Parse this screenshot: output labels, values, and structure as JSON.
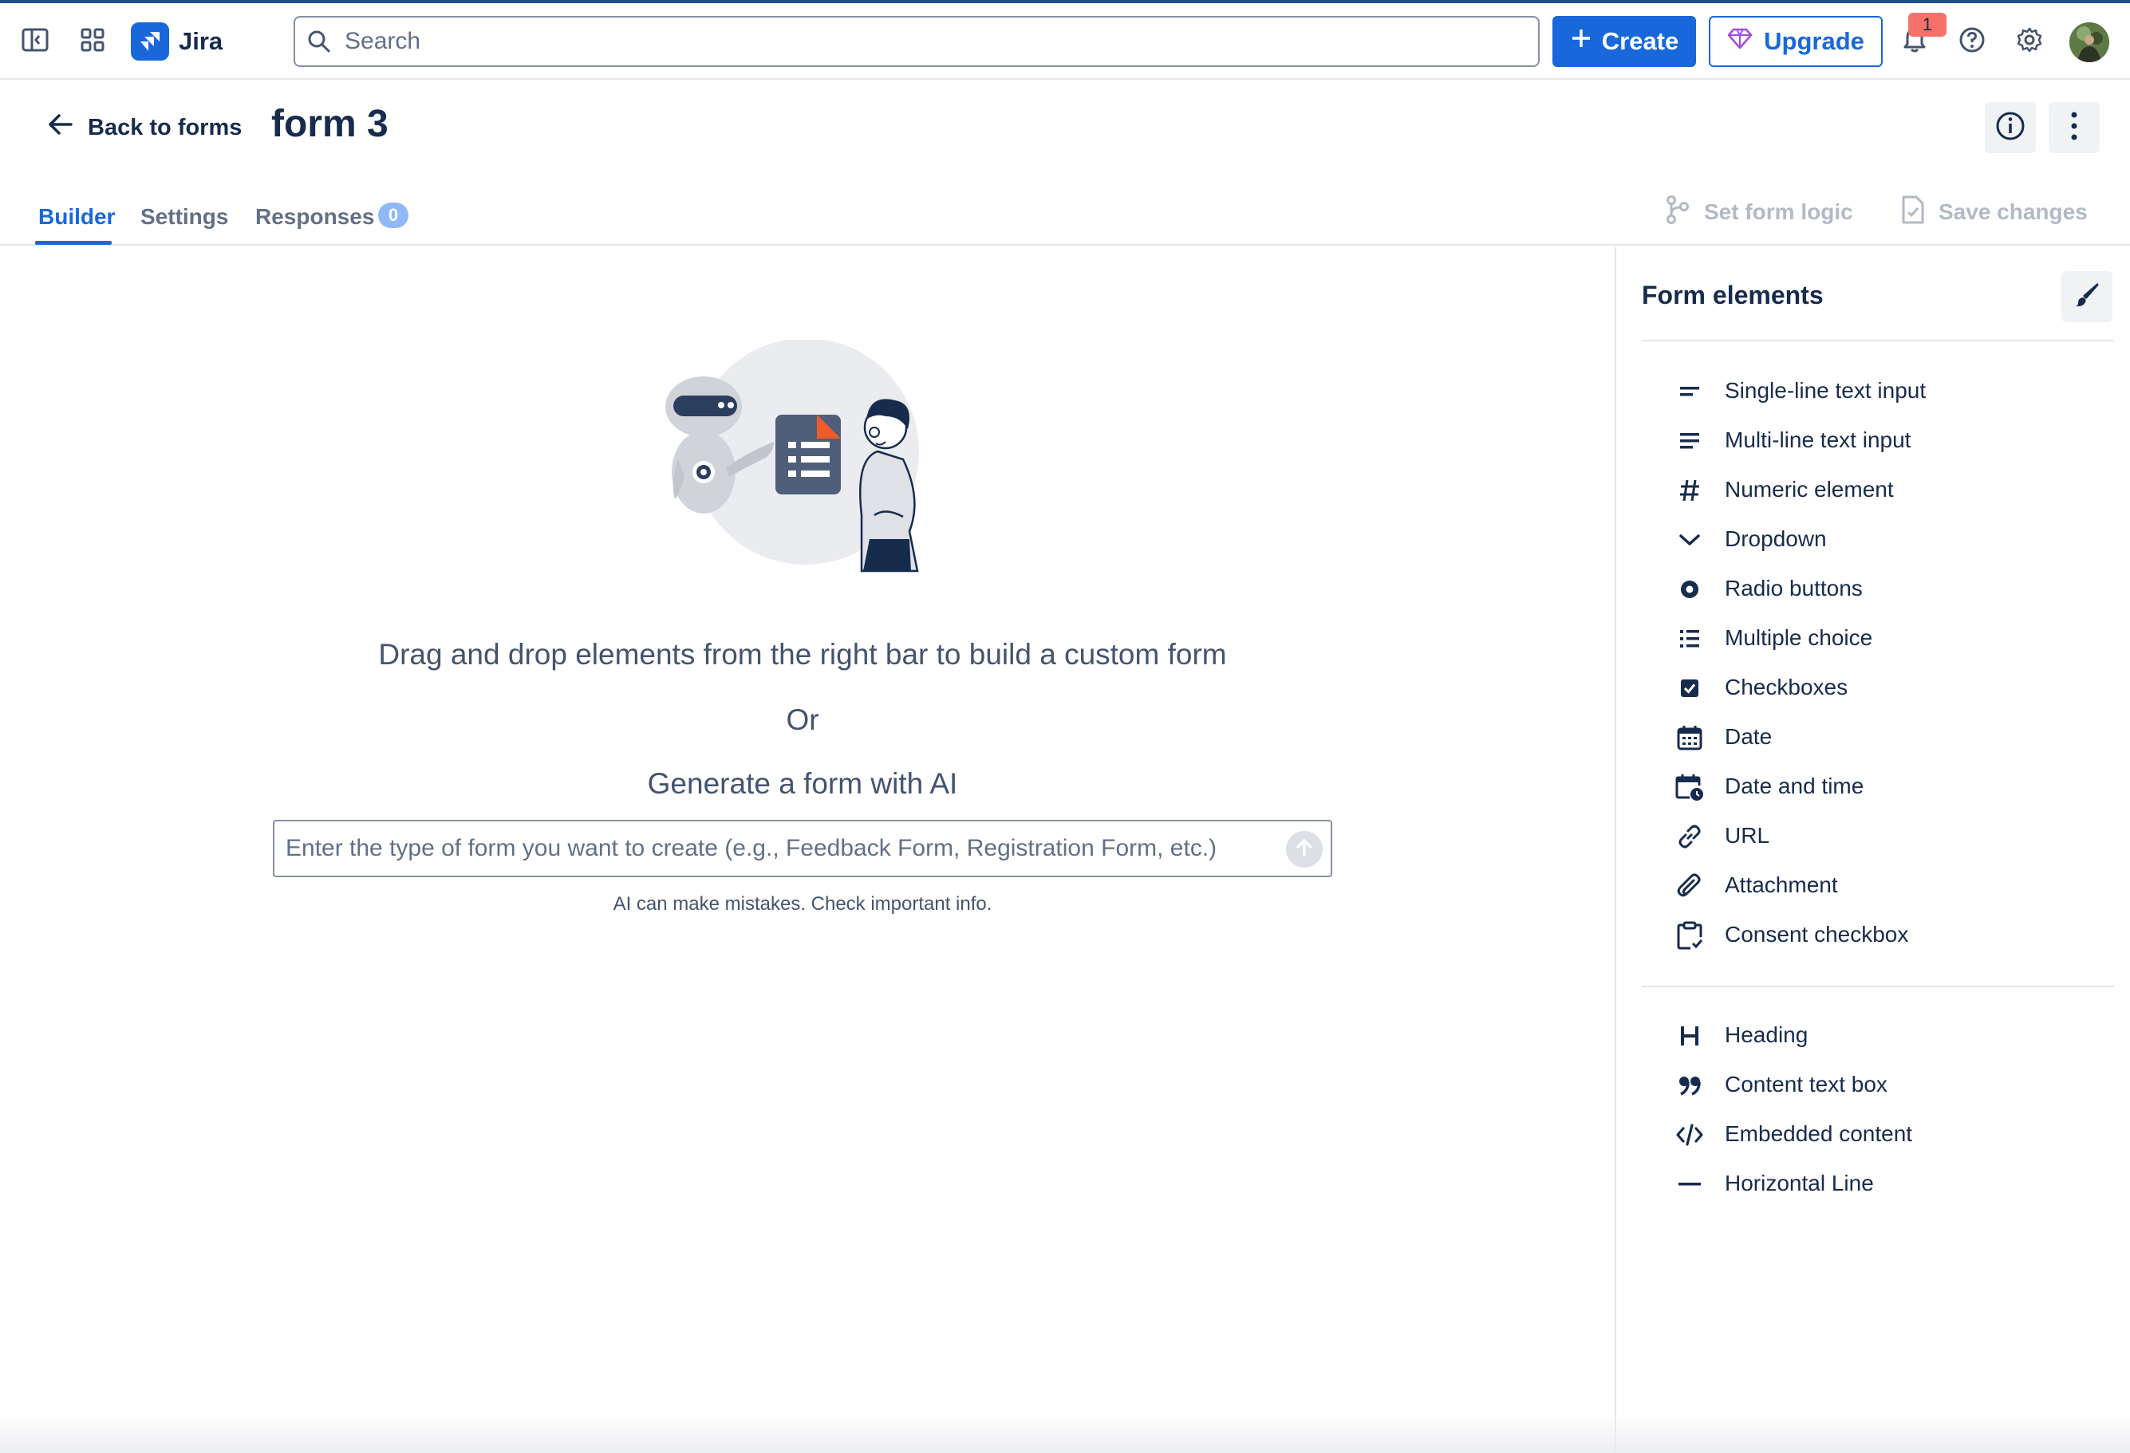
{
  "app": {
    "name": "Jira"
  },
  "topbar": {
    "search_placeholder": "Search",
    "create_label": "Create",
    "upgrade_label": "Upgrade",
    "notification_count": "1"
  },
  "page": {
    "back_label": "Back to forms",
    "title": "form 3"
  },
  "tabs": [
    {
      "label": "Builder",
      "active": true
    },
    {
      "label": "Settings",
      "active": false
    },
    {
      "label": "Responses",
      "active": false,
      "count": "0"
    }
  ],
  "actions": {
    "set_logic_label": "Set form logic",
    "save_label": "Save changes"
  },
  "builder": {
    "instructions": "Drag and drop elements from the right bar to build a custom form",
    "or_label": "Or",
    "generate_label": "Generate a form with AI",
    "ai_placeholder": "Enter the type of form you want to create (e.g., Feedback Form, Registration Form, etc.)",
    "ai_disclaimer": "AI can make mistakes. Check important info."
  },
  "sidebar": {
    "title": "Form elements",
    "input_elements": [
      {
        "label": "Single-line text input",
        "icon": "short-text-icon"
      },
      {
        "label": "Multi-line text input",
        "icon": "long-text-icon"
      },
      {
        "label": "Numeric element",
        "icon": "hash-icon"
      },
      {
        "label": "Dropdown",
        "icon": "chevron-down-icon"
      },
      {
        "label": "Radio buttons",
        "icon": "radio-icon"
      },
      {
        "label": "Multiple choice",
        "icon": "list-icon"
      },
      {
        "label": "Checkboxes",
        "icon": "checkbox-icon"
      },
      {
        "label": "Date",
        "icon": "calendar-icon"
      },
      {
        "label": "Date and time",
        "icon": "calendar-clock-icon"
      },
      {
        "label": "URL",
        "icon": "link-icon"
      },
      {
        "label": "Attachment",
        "icon": "paperclip-icon"
      },
      {
        "label": "Consent checkbox",
        "icon": "clipboard-check-icon"
      }
    ],
    "content_elements": [
      {
        "label": "Heading",
        "icon": "heading-icon"
      },
      {
        "label": "Content text box",
        "icon": "quote-icon"
      },
      {
        "label": "Embedded content",
        "icon": "code-icon"
      },
      {
        "label": "Horizontal Line",
        "icon": "horizontal-line-icon"
      }
    ]
  },
  "colors": {
    "brand": "#1868db",
    "text": "#172b4d",
    "muted": "#626f86",
    "disabled": "#b3b9c4",
    "notification": "#f87168"
  }
}
